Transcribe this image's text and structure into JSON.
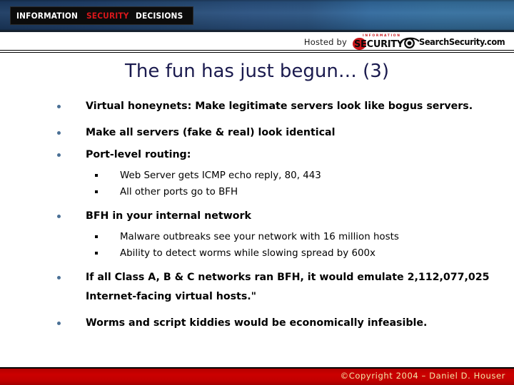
{
  "header": {
    "logo": {
      "part1": "INFORMATION",
      "part2": "SECURITY",
      "part3": "DECISIONS",
      "accent_color": "#d8171b",
      "background_color": "#0b0b0b"
    },
    "band_color_left": "#1d3c63",
    "band_color_right": "#366f9d"
  },
  "hosted": {
    "label": "Hosted by",
    "magazine": {
      "kicker": "INFORMATION",
      "word": "SECURITY",
      "blob_color": "#c8161b"
    },
    "site": {
      "name": "SearchSecurity.com",
      "icon": "eye-icon"
    }
  },
  "title": "The fun has just begun… (3)",
  "bullets": [
    {
      "level": 1,
      "text": "Virtual honeynets: Make legitimate servers look like bogus servers."
    },
    {
      "level": 1,
      "text": "Make all servers (fake & real) look identical"
    },
    {
      "level": 1,
      "text": "Port-level routing:"
    },
    {
      "level": 2,
      "text": "Web Server gets ICMP echo reply, 80, 443"
    },
    {
      "level": 2,
      "text": "All other ports go to BFH"
    },
    {
      "level": 1,
      "text": "BFH in your internal network"
    },
    {
      "level": 2,
      "text": "Malware outbreaks see your network with 16 million hosts"
    },
    {
      "level": 2,
      "text": "Ability to detect worms while slowing spread by 600x"
    },
    {
      "level": 1,
      "text": "If all Class A, B & C networks ran BFH, it would emulate 2,112,077,025 Internet-facing virtual hosts.\""
    },
    {
      "level": 1,
      "text": "Worms and script kiddies would be economically infeasible."
    }
  ],
  "footer": {
    "copyright": "©Copyright 2004 – Daniel D. Houser",
    "bar_color": "#cc0000",
    "text_color": "#f2e6a8"
  }
}
